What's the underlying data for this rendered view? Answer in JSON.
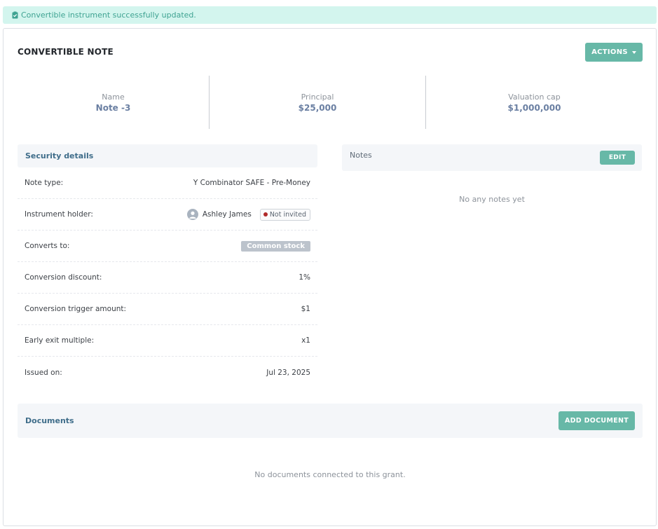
{
  "alert": {
    "message": "Convertible instrument successfully updated."
  },
  "header": {
    "title": "CONVERTIBLE NOTE",
    "actions_label": "ACTIONS"
  },
  "stats": [
    {
      "label": "Name",
      "value": "Note -3"
    },
    {
      "label": "Principal",
      "value": "$25,000"
    },
    {
      "label": "Valuation cap",
      "value": "$1,000,000"
    }
  ],
  "security": {
    "title": "Security details",
    "rows": [
      {
        "label": "Note type:",
        "value": "Y Combinator SAFE - Pre-Money"
      },
      {
        "label": "Instrument holder:",
        "value": "Ashley James",
        "badge": "Not invited"
      },
      {
        "label": "Converts to:",
        "value": "Common stock"
      },
      {
        "label": "Conversion discount:",
        "value": "1%"
      },
      {
        "label": "Conversion trigger amount:",
        "value": "$1"
      },
      {
        "label": "Early exit multiple:",
        "value": "x1"
      },
      {
        "label": "Issued on:",
        "value": "Jul 23, 2025"
      }
    ]
  },
  "notes": {
    "title": "Notes",
    "edit_label": "EDIT",
    "empty_text": "No any notes yet"
  },
  "documents": {
    "title": "Documents",
    "add_label": "ADD DOCUMENT",
    "empty_text": "No documents connected to this grant."
  },
  "colors": {
    "accent": "#67b8a7",
    "alert_bg": "#d3f5ee",
    "alert_text": "#3fa392",
    "badge_dot": "#b02a2a"
  },
  "icons": {
    "alert": "clipboard-check-icon",
    "actions": "caret-down-icon",
    "holder": "user-avatar-icon"
  }
}
